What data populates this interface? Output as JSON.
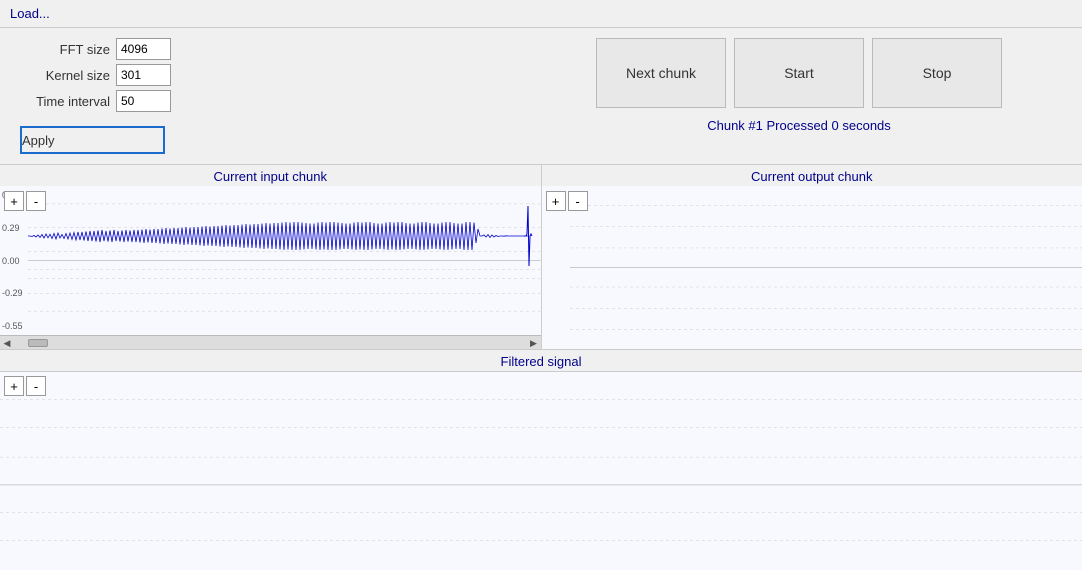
{
  "topbar": {
    "load_label": "Load..."
  },
  "params": {
    "fft_label": "FFT size",
    "fft_value": "4096",
    "kernel_label": "Kernel size",
    "kernel_value": "301",
    "time_label": "Time interval",
    "time_value": "50"
  },
  "buttons": {
    "apply_label": "Apply",
    "next_chunk_label": "Next chunk",
    "start_label": "Start",
    "stop_label": "Stop"
  },
  "status": {
    "text": "Chunk #1 Processed 0 seconds"
  },
  "input_chart": {
    "title": "Current input chunk",
    "y_labels": [
      "0.58",
      "0.29",
      "0.00",
      "-0.29",
      "-0.55"
    ],
    "zoom_plus": "+",
    "zoom_minus": "-"
  },
  "output_chart": {
    "title": "Current output chunk",
    "zoom_plus": "+",
    "zoom_minus": "-"
  },
  "filtered_chart": {
    "title": "Filtered signal",
    "zoom_plus": "+",
    "zoom_minus": "-"
  },
  "colors": {
    "waveform": "#0000cc",
    "title_text": "#00008b",
    "button_border": "#1a6bcc"
  }
}
